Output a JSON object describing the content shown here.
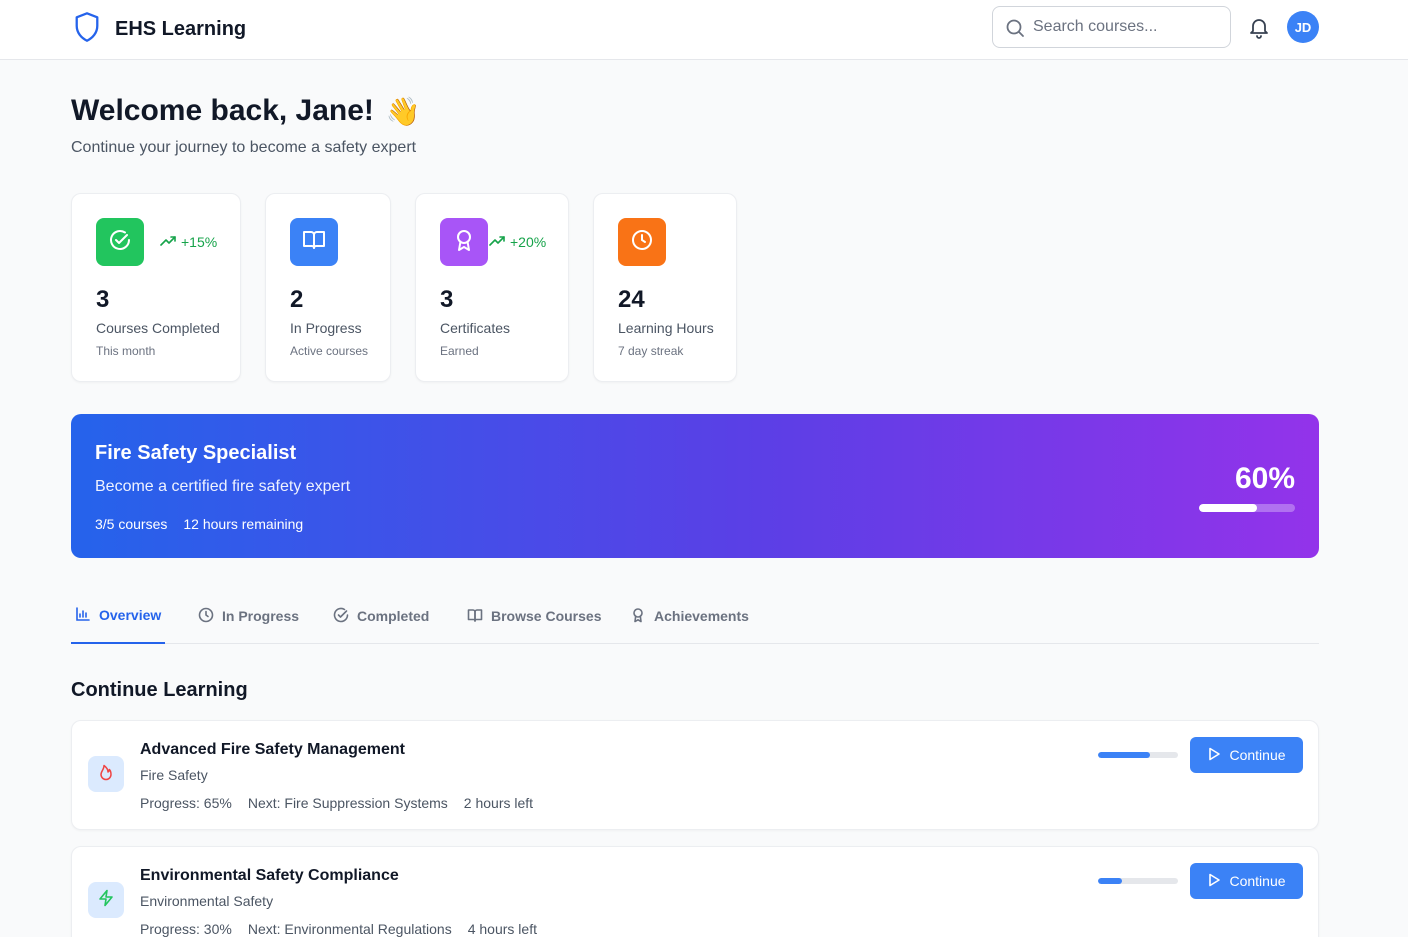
{
  "header": {
    "brand": "EHS Learning",
    "search_placeholder": "Search courses...",
    "avatar_initials": "JD"
  },
  "welcome": {
    "title": "Welcome back, Jane!",
    "emoji": "👋",
    "subtitle": "Continue your journey to become a safety expert"
  },
  "stats": [
    {
      "value": "3",
      "label": "Courses Completed",
      "note": "This month",
      "trend": "+15%",
      "icon": "check-circle-icon",
      "color": "#22c55e"
    },
    {
      "value": "2",
      "label": "In Progress",
      "note": "Active courses",
      "trend": "",
      "icon": "book-open-icon",
      "color": "#3b82f6"
    },
    {
      "value": "3",
      "label": "Certificates",
      "note": "Earned",
      "trend": "+20%",
      "icon": "award-icon",
      "color": "#a855f7"
    },
    {
      "value": "24",
      "label": "Learning Hours",
      "note": "7 day streak",
      "trend": "",
      "icon": "clock-icon",
      "color": "#f97316"
    }
  ],
  "banner": {
    "title": "Fire Safety Specialist",
    "subtitle": "Become a certified fire safety expert",
    "courses": "3/5 courses",
    "remaining": "12 hours remaining",
    "percent_label": "60%",
    "progress": 0.6
  },
  "tabs": [
    {
      "label": "Overview",
      "icon": "bar-chart-icon",
      "active": true
    },
    {
      "label": "In Progress",
      "icon": "clock-icon",
      "active": false
    },
    {
      "label": "Completed",
      "icon": "check-circle-icon",
      "active": false
    },
    {
      "label": "Browse Courses",
      "icon": "book-open-icon",
      "active": false
    },
    {
      "label": "Achievements",
      "icon": "award-icon",
      "active": false
    }
  ],
  "continue_learning": {
    "title": "Continue Learning",
    "courses": [
      {
        "title": "Advanced Fire Safety Management",
        "category": "Fire Safety",
        "progress_label": "Progress: 65%",
        "next": "Next: Fire Suppression Systems",
        "time_left": "2 hours left",
        "progress": 0.65,
        "icon": "flame-icon",
        "icon_color": "#ef4444",
        "icon_bg": "#dbeafe",
        "button": "Continue"
      },
      {
        "title": "Environmental Safety Compliance",
        "category": "Environmental Safety",
        "progress_label": "Progress: 30%",
        "next": "Next: Environmental Regulations",
        "time_left": "4 hours left",
        "progress": 0.3,
        "icon": "zap-icon",
        "icon_color": "#22c55e",
        "icon_bg": "#dbeafe",
        "button": "Continue"
      }
    ]
  }
}
